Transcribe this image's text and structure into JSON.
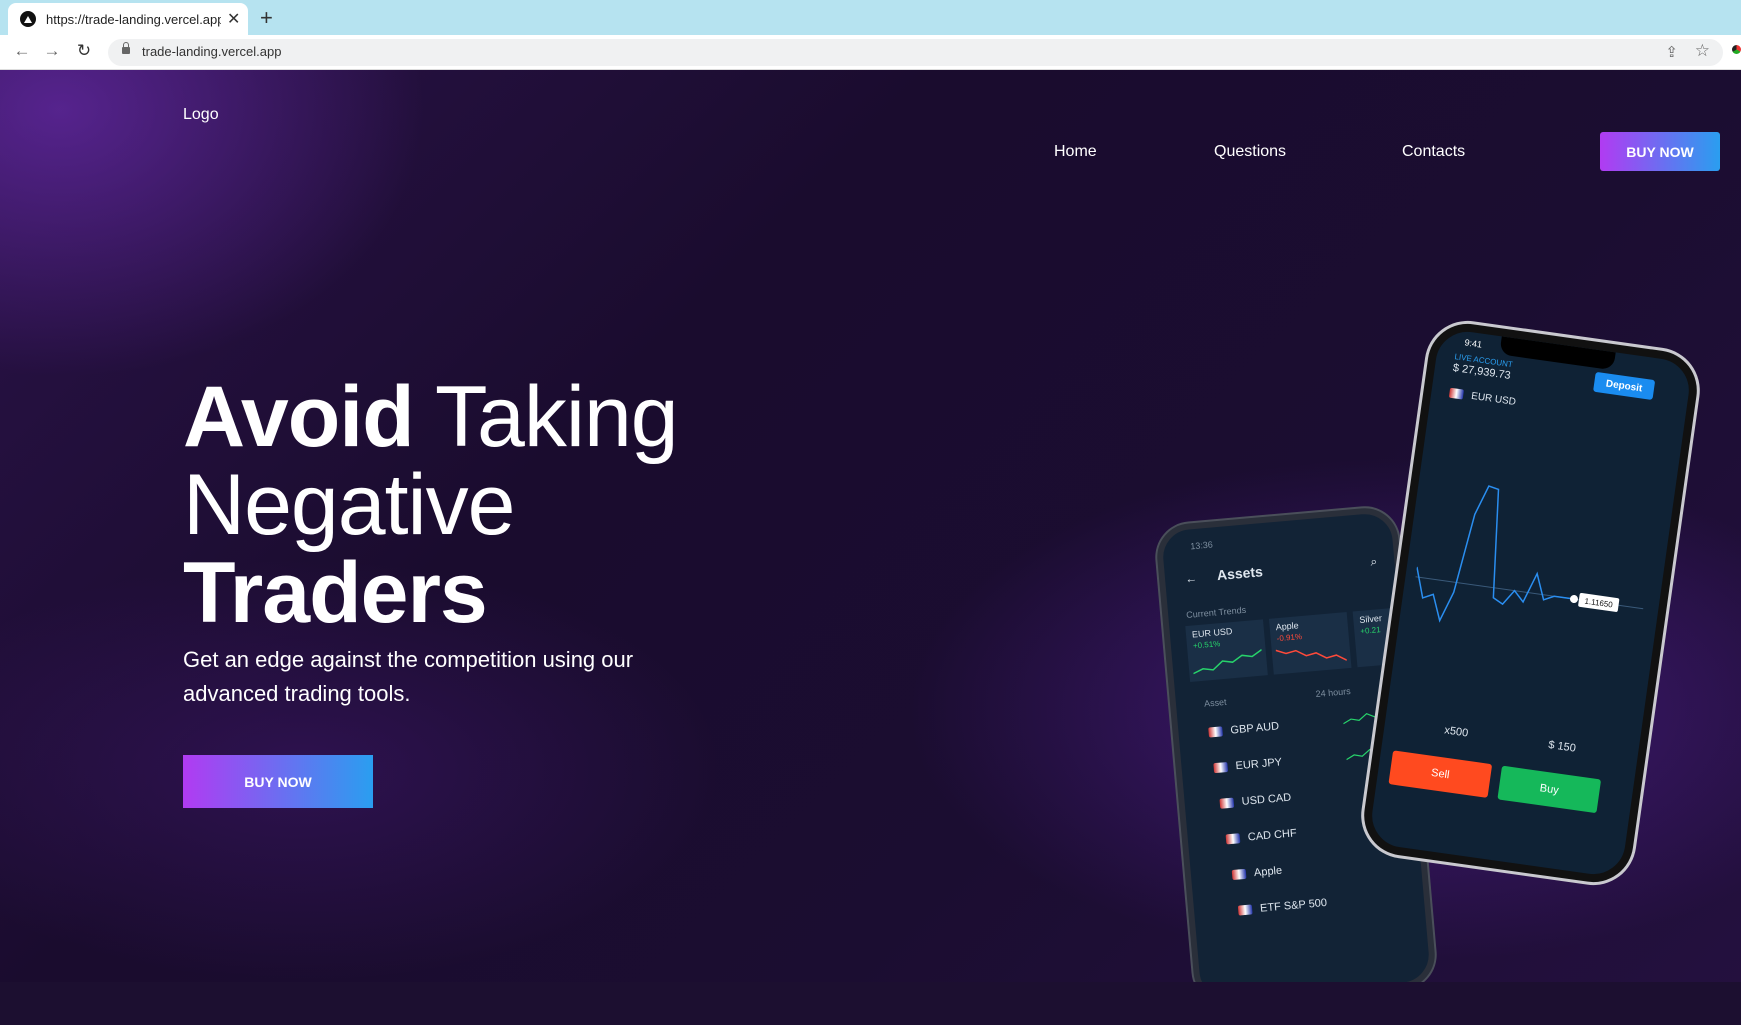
{
  "browser": {
    "tab_title": "https://trade-landing.vercel.app",
    "url": "trade-landing.vercel.app"
  },
  "site": {
    "logo": "Logo",
    "nav": [
      "Home",
      "Questions",
      "Contacts"
    ],
    "buy_top": "BUY NOW"
  },
  "hero": {
    "line1_bold": "Avoid",
    "line1_thin": "Taking",
    "line2": "Negative",
    "line3": "Traders",
    "subtitle": "Get an edge against the competition using our advanced trading tools.",
    "cta": "BUY NOW"
  },
  "phone_back": {
    "time": "13:36",
    "title": "Assets",
    "section": "Current Trends",
    "trends": [
      {
        "name": "EUR USD",
        "change": "+0.51%"
      },
      {
        "name": "Apple",
        "change": "-0.91%"
      },
      {
        "name": "Silver",
        "change": "+0.21"
      }
    ],
    "col_asset": "Asset",
    "col_period": "24 hours",
    "assets": [
      "GBP AUD",
      "EUR JPY",
      "USD CAD",
      "CAD CHF",
      "Apple",
      "ETF S&P 500"
    ]
  },
  "phone_front": {
    "time": "9:41",
    "account_label": "LIVE ACCOUNT",
    "balance": "$ 27,939.73",
    "deposit": "Deposit",
    "pair": "EUR USD",
    "price_tag": "1.11650",
    "multiplier": "x500",
    "amount": "$ 150",
    "sell": "Sell",
    "buy": "Buy"
  },
  "colors": {
    "cta_gradient_start": "#b13bf2",
    "cta_gradient_end": "#2a9ef0",
    "sell": "#ff4a1f",
    "buy": "#15b85a"
  }
}
